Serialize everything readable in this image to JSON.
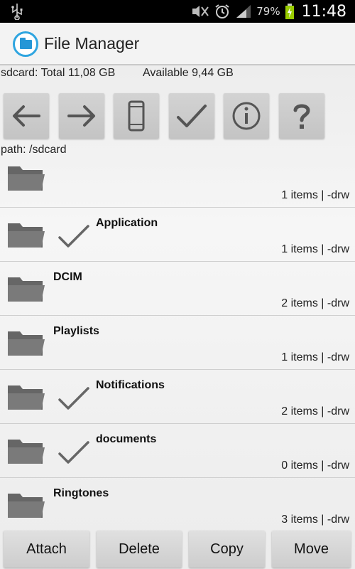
{
  "status_bar": {
    "battery_percent": "79%",
    "time": "11:48",
    "icons": [
      "usb-icon",
      "mute-icon",
      "alarm-icon",
      "signal-icon",
      "battery-charging-icon"
    ]
  },
  "action_bar": {
    "title": "File Manager",
    "accent_color": "#2fa5e0"
  },
  "storage": {
    "total": "sdcard: Total 11,08 GB",
    "available": "Available 9,44 GB"
  },
  "toolbar": {
    "buttons": [
      "back-arrow-icon",
      "forward-arrow-icon",
      "phone-icon",
      "checkmark-icon",
      "info-icon",
      "help-icon"
    ]
  },
  "path": "path: /sdcard",
  "files": [
    {
      "name": "",
      "meta": "1 items | -drw",
      "checked": false
    },
    {
      "name": "Application",
      "meta": "1 items | -drw",
      "checked": true
    },
    {
      "name": "DCIM",
      "meta": "2 items | -drw",
      "checked": false
    },
    {
      "name": "Playlists",
      "meta": "1 items | -drw",
      "checked": false
    },
    {
      "name": "Notifications",
      "meta": "2 items | -drw",
      "checked": true
    },
    {
      "name": "documents",
      "meta": "0 items | -drw",
      "checked": true
    },
    {
      "name": "Ringtones",
      "meta": "3 items | -drw",
      "checked": false
    }
  ],
  "bottom_buttons": {
    "attach": "Attach",
    "delete": "Delete",
    "copy": "Copy",
    "move": "Move"
  }
}
